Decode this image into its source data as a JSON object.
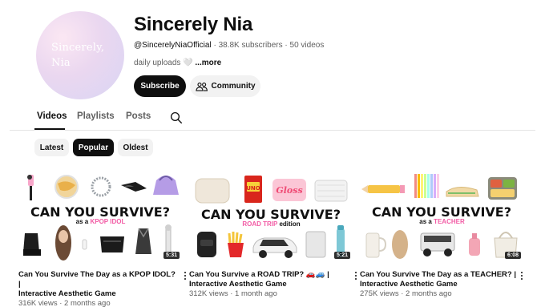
{
  "channel": {
    "avatar_text_line1": "Sincerely,",
    "avatar_text_line2": "Nia",
    "name": "Sincerely Nia",
    "handle": "@SincerelyNiaOfficial",
    "subscribers": "38.8K subscribers",
    "videos_count": "50 videos",
    "separator": "·",
    "description": "daily uploads",
    "description_emoji": "🤍",
    "more_label": "...more",
    "subscribe_label": "Subscribe",
    "community_label": "Community"
  },
  "tabs": [
    {
      "label": "Videos",
      "active": true
    },
    {
      "label": "Playlists",
      "active": false
    },
    {
      "label": "Posts",
      "active": false
    }
  ],
  "chips": [
    {
      "label": "Latest",
      "active": false
    },
    {
      "label": "Popular",
      "active": true
    },
    {
      "label": "Oldest",
      "active": false
    }
  ],
  "videos": [
    {
      "thumb_title": "CAN YOU SURVIVE?",
      "thumb_sub_prefix": "as a",
      "thumb_sub_pink": "KPOP IDOL",
      "thumb_sub_suffix": "",
      "duration": "5:31",
      "title_line1": "Can You Survive The Day as a KPOP IDOL? |",
      "title_line2": "Interactive Aesthetic Game",
      "views": "316K views",
      "age": "2 months ago"
    },
    {
      "thumb_title": "CAN YOU SURVIVE?",
      "thumb_sub_prefix": "",
      "thumb_sub_pink": "ROAD TRIP",
      "thumb_sub_suffix": "edition",
      "duration": "5:21",
      "title_line1": "Can You Survive a ROAD TRIP? 🚗🚙 |",
      "title_line2": "Interactive Aesthetic Game",
      "views": "312K views",
      "age": "1 month ago"
    },
    {
      "thumb_title": "CAN YOU SURVIVE?",
      "thumb_sub_prefix": "as a",
      "thumb_sub_pink": "TEACHER",
      "thumb_sub_suffix": "",
      "duration": "6:08",
      "title_line1": "Can You Survive The Day as a TEACHER? |",
      "title_line2": "Interactive Aesthetic Game",
      "views": "275K views",
      "age": "2 months ago"
    }
  ],
  "thumb_labels": {
    "uno": "UNO",
    "gloss": "Gloss"
  },
  "colors": {
    "accent_pink": "#f25ca5",
    "dark": "#0f0f0f",
    "muted": "#606060"
  }
}
